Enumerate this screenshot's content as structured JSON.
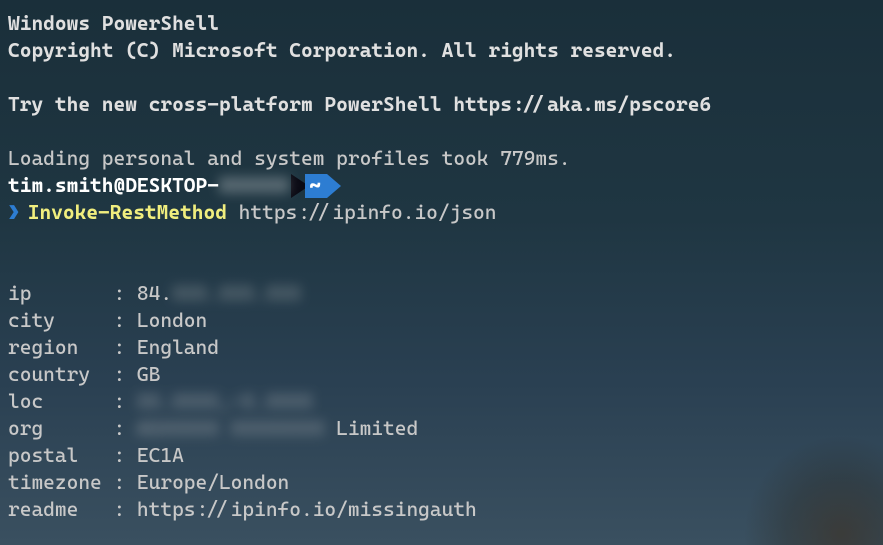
{
  "header": {
    "title": "Windows PowerShell",
    "copyright": "Copyright (C) Microsoft Corporation. All rights reserved.",
    "hint": "Try the new cross-platform PowerShell https://aka.ms/pscore6",
    "profile_load": "Loading personal and system profiles took 779ms."
  },
  "prompt": {
    "user_host": "tim.smith@DESKTOP-",
    "redacted_host": "XXXXXX",
    "cwd_symbol": "~",
    "chevron": "❯"
  },
  "command": {
    "name": "Invoke-RestMethod",
    "arg": "https://ipinfo.io/json"
  },
  "output": {
    "rows": [
      {
        "key": "ip      ",
        "sep": " : ",
        "value": "84.",
        "redacted_tail": "XXX.XXX.XXX"
      },
      {
        "key": "city    ",
        "sep": " : ",
        "value": "London"
      },
      {
        "key": "region  ",
        "sep": " : ",
        "value": "England"
      },
      {
        "key": "country ",
        "sep": " : ",
        "value": "GB"
      },
      {
        "key": "loc     ",
        "sep": " : ",
        "value": "",
        "redacted_tail": "XX.XXXX,-X.XXXX"
      },
      {
        "key": "org     ",
        "sep": " : ",
        "value": "",
        "redacted_tail": "ASXXXXX XXXXXXXX",
        "suffix": " Limited"
      },
      {
        "key": "postal  ",
        "sep": " : ",
        "value": "EC1A"
      },
      {
        "key": "timezone",
        "sep": " : ",
        "value": "Europe/London"
      },
      {
        "key": "readme  ",
        "sep": " : ",
        "value": "https://ipinfo.io/missingauth"
      }
    ]
  }
}
